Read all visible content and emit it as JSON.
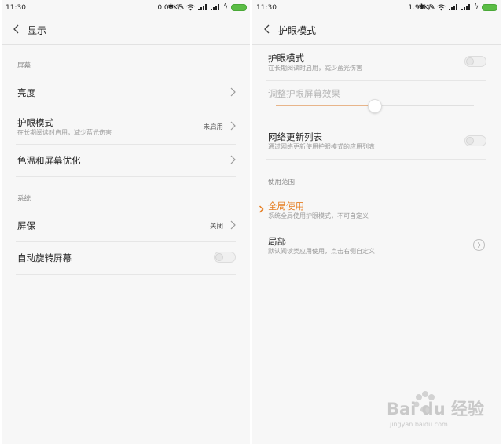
{
  "left": {
    "status": {
      "time": "11:30",
      "speed": "0.00K/s"
    },
    "title": "显示",
    "section_screen": "屏幕",
    "brightness": "亮度",
    "eye_mode": {
      "title": "护眼模式",
      "subtitle": "在长期阅读时启用，减少蓝光伤害",
      "value": "未启用"
    },
    "color_temp": "色温和屏幕优化",
    "section_system": "系统",
    "screensaver": {
      "title": "屏保",
      "value": "关闭"
    },
    "auto_rotate": {
      "title": "自动旋转屏幕",
      "enabled": false
    }
  },
  "right": {
    "status": {
      "time": "11:30",
      "speed": "1.94K/s"
    },
    "title": "护眼模式",
    "eye_mode": {
      "title": "护眼模式",
      "subtitle": "在长期阅读时启用，减少蓝光伤害",
      "enabled": false
    },
    "adjust_label": "调整护眼屏幕效果",
    "adjust_level": 0.5,
    "network_list": {
      "title": "网络更新列表",
      "subtitle": "通过网络更新使用护眼模式的应用列表",
      "enabled": false
    },
    "section_scope": "使用范围",
    "global_use": {
      "title": "全局使用",
      "subtitle": "系统全局使用护眼模式，不可自定义",
      "selected": true
    },
    "partial": {
      "title": "局部",
      "subtitle": "默认阅读类应用使用，点击右侧自定义"
    }
  },
  "watermark": {
    "main": "Bai du 经验",
    "sub": "jingyan.baidu.com"
  },
  "colors": {
    "accent": "#e67e22",
    "background": "#f7f7f7",
    "toggle_on": "#5bbd45"
  },
  "icons": [
    "back-arrow-icon",
    "chevron-right-icon",
    "bluetooth-icon",
    "alarm-icon",
    "wifi-icon",
    "signal-icon",
    "battery-icon",
    "charging-icon",
    "circle-chevron-icon",
    "selected-indicator-icon"
  ]
}
